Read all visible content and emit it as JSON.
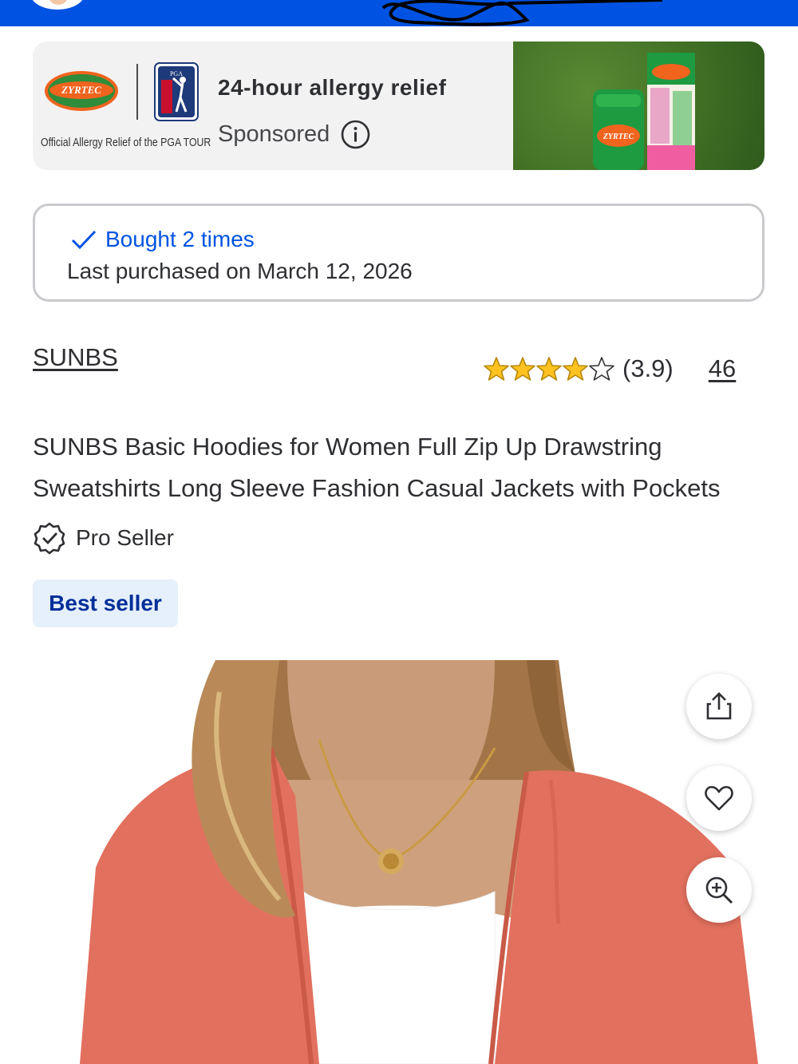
{
  "ad": {
    "brand": "ZYRTEC",
    "partner": "PGA TOUR",
    "tagline": "Official Allergy Relief of the PGA TOUR",
    "headline": "24-hour allergy relief",
    "sponsored_label": "Sponsored",
    "product_brand": "ZYRTEC"
  },
  "purchase_history": {
    "bought_label": "Bought 2 times",
    "last_purchased": "Last purchased on March 12, 2026"
  },
  "product": {
    "brand": "SUNBS",
    "rating": 3.9,
    "rating_label": "(3.9)",
    "review_count": "46",
    "title": "SUNBS Basic Hoodies for Women Full Zip Up Drawstring Sweatshirts Long Sleeve Fashion Casual Jackets with Pockets",
    "seller_badge": "Pro Seller",
    "tag": "Best seller"
  },
  "image_actions": [
    "share-icon",
    "heart-icon",
    "zoom-in-icon"
  ],
  "colors": {
    "brand_blue": "#0053e2",
    "star": "#ffc220",
    "best_seller_bg": "#e6f0fc",
    "best_seller_text": "#002e99",
    "hoodie": "#e2705e"
  }
}
